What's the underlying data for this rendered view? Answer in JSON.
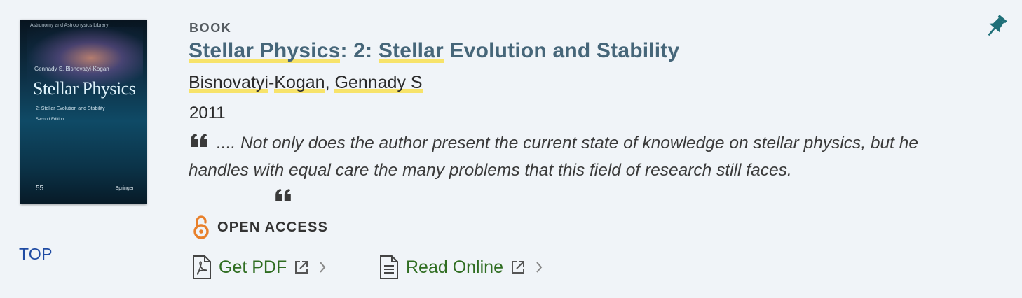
{
  "result": {
    "cover": {
      "series": "Astronomy and Astrophysics Library",
      "author": "Gennady S. Bisnovatyi-Kogan",
      "title": "Stellar Physics",
      "subtitle": "2: Stellar Evolution and Stability",
      "edition": "Second Edition",
      "logo_left": "55",
      "logo_right": "Springer"
    },
    "type_label": "BOOK",
    "title_parts": [
      "Stellar Physics",
      ": 2: ",
      "Stellar",
      " Evolution and Stability"
    ],
    "authors_parts": [
      "Bisnovatyi",
      "-",
      "Kogan",
      ", ",
      "Gennady S"
    ],
    "year": "2011",
    "abstract": ".... Not only does the author present the current state of knowledge on stellar physics, but he handles with equal care the many problems that this field of research still faces.",
    "open_access_label": "OPEN ACCESS",
    "actions": [
      {
        "label": "Get PDF",
        "icon": "pdf-file-icon"
      },
      {
        "label": "Read Online",
        "icon": "document-icon"
      }
    ],
    "top_link": "TOP"
  },
  "colors": {
    "title": "#466679",
    "highlight": "#f7e36a",
    "action": "#2f6d21",
    "open_access": "#e8802b",
    "pin": "#1f6f78",
    "top_link": "#1f4ba3"
  }
}
